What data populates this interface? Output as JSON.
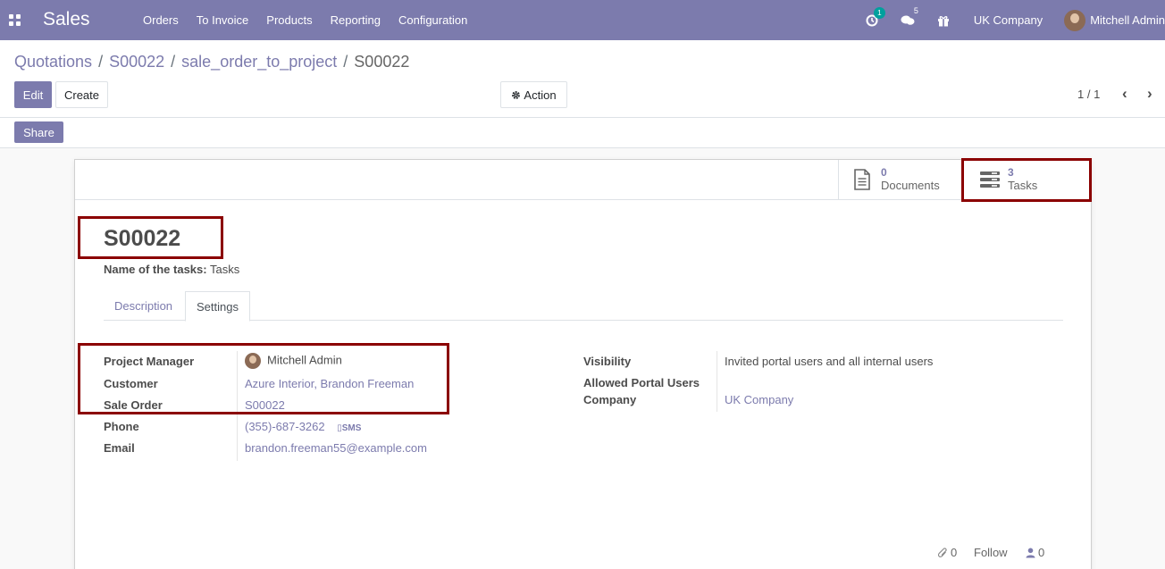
{
  "navbar": {
    "app_name": "Sales",
    "menu": [
      "Orders",
      "To Invoice",
      "Products",
      "Reporting",
      "Configuration"
    ],
    "activity_badge": "1",
    "messages_badge": "5",
    "company": "UK Company",
    "user": "Mitchell Admin"
  },
  "breadcrumb": {
    "items": [
      "Quotations",
      "S00022",
      "sale_order_to_project"
    ],
    "current": "S00022",
    "separator": "/"
  },
  "toolbar": {
    "edit_label": "Edit",
    "create_label": "Create",
    "action_label": "Action",
    "share_label": "Share",
    "pager": "1 / 1"
  },
  "stat_buttons": {
    "documents": {
      "value": "0",
      "label": "Documents"
    },
    "tasks": {
      "value": "3",
      "label": "Tasks"
    }
  },
  "form": {
    "title": "S00022",
    "tasks_name_label": "Name of the tasks:",
    "tasks_name_value": "Tasks",
    "tabs": [
      "Description",
      "Settings"
    ],
    "left_group": {
      "project_manager_label": "Project Manager",
      "project_manager_value": "Mitchell Admin",
      "customer_label": "Customer",
      "customer_value": "Azure Interior, Brandon Freeman",
      "sale_order_label": "Sale Order",
      "sale_order_value": "S00022",
      "phone_label": "Phone",
      "phone_value": "(355)-687-3262",
      "sms_label": "SMS",
      "email_label": "Email",
      "email_value": "brandon.freeman55@example.com"
    },
    "right_group": {
      "visibility_label": "Visibility",
      "visibility_value": "Invited portal users and all internal users",
      "allowed_label": "Allowed Portal Users",
      "company_label": "Company",
      "company_value": "UK Company"
    }
  },
  "chatter": {
    "attachments_count": "0",
    "follow_label": "Follow",
    "followers_count": "0"
  },
  "colors": {
    "brand": "#7c7bad",
    "highlight": "#8b0000",
    "accent_badge": "#00a09d"
  }
}
